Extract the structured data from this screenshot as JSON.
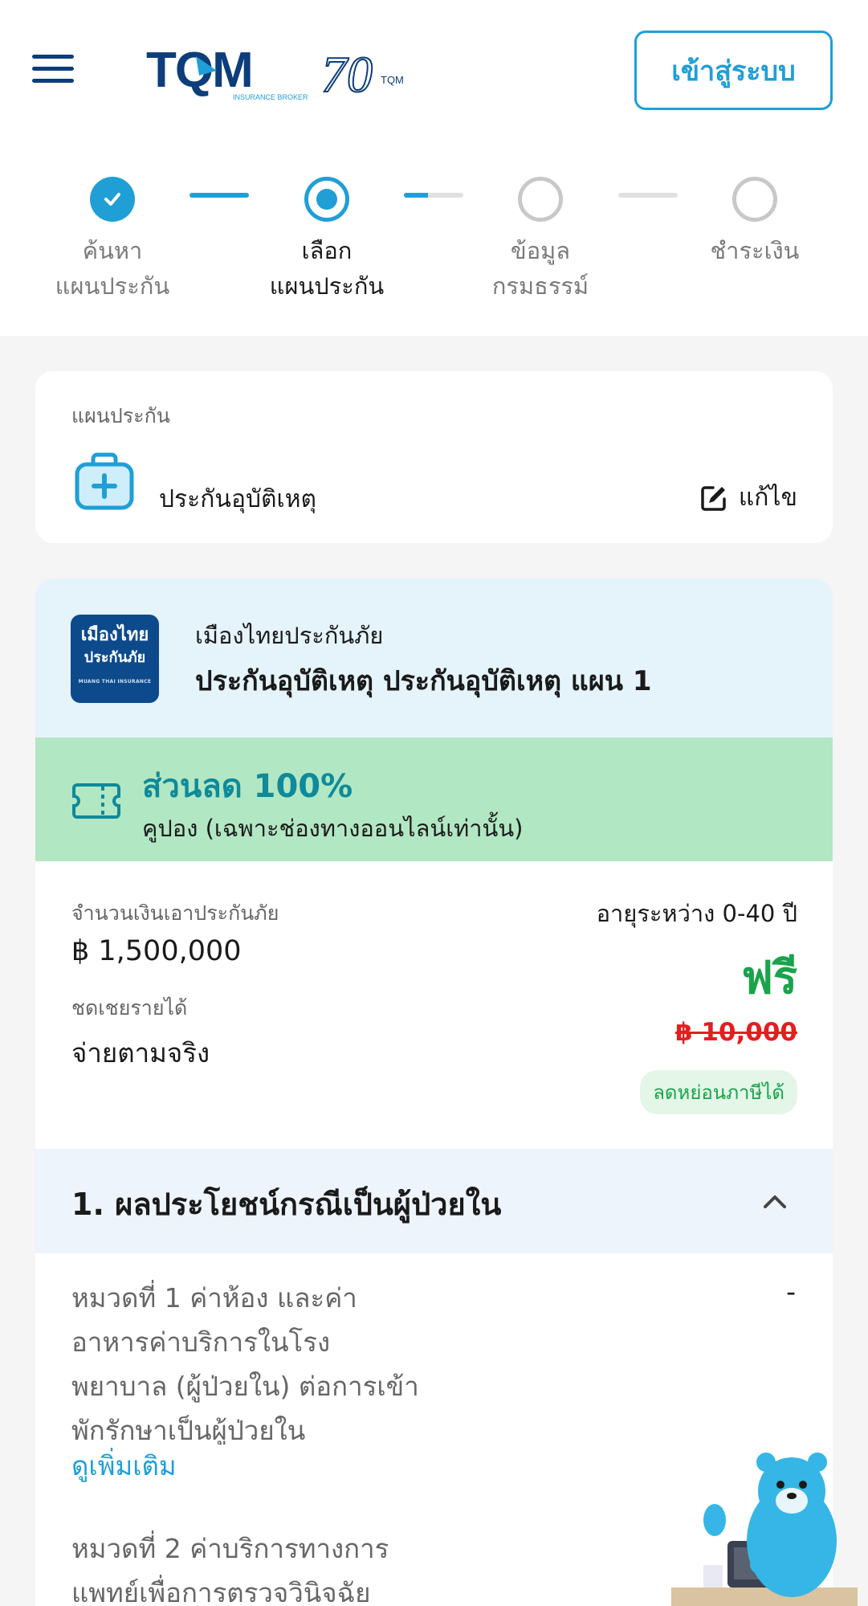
{
  "header": {
    "login_label": "เข้าสู่ระบบ",
    "logo_text": "TQM",
    "logo_sub": "INSURANCE BROKER",
    "anniversary_text": "70",
    "anniversary_sub": "TQM"
  },
  "stepper": {
    "steps": [
      {
        "line1": "ค้นหา",
        "line2": "แผนประกัน",
        "state": "done"
      },
      {
        "line1": "เลือก",
        "line2": "แผนประกัน",
        "state": "active"
      },
      {
        "line1": "ข้อมูล",
        "line2": "กรมธรรม์",
        "state": "todo"
      },
      {
        "line1": "ชำระเงิน",
        "line2": "",
        "state": "todo"
      }
    ]
  },
  "plan_type": {
    "label": "แผนประกัน",
    "name": "ประกันอุบัติเหตุ",
    "edit_label": "แก้ไข"
  },
  "insurer": {
    "logo_line1": "เมืองไทย",
    "logo_line2": "ประกันภัย",
    "logo_line3": "MUANG THAI INSURANCE",
    "name": "เมืองไทยประกันภัย",
    "plan_title": "ประกันอุบัติเหตุ ประกันอุบัติเหตุ แผน 1"
  },
  "discount": {
    "title": "ส่วนลด 100%",
    "subtitle": "คูปอง (เฉพาะช่องทางออนไลน์เท่านั้น)"
  },
  "price": {
    "sum_insured_label": "จำนวนเงินเอาประกันภัย",
    "sum_insured_value": "฿ 1,500,000",
    "compensation_label": "ชดเชยรายได้",
    "compensation_value": "จ่ายตามจริง",
    "age_range": "อายุระหว่าง 0-40 ปี",
    "price_now": "ฟรี",
    "price_old": "฿ 10,000",
    "tax_badge": "ลดหย่อนภาษีได้"
  },
  "benefits": {
    "section_title": "1. ผลประโยชน์กรณีเป็นผู้ป่วยใน",
    "item1_text": "หมวดที่ 1 ค่าห้อง และค่าอาหารค่าบริการในโรงพยาบาล (ผู้ป่วยใน) ต่อการเข้าพักรักษาเป็นผู้ป่วยใน",
    "item1_value": "-",
    "more_label": "ดูเพิ่มเติม",
    "item2_text": "หมวดที่ 2 ค่าบริการทางการแพทย์เพื่อการตรวจวินิจฉัย"
  },
  "colors": {
    "brand_blue": "#1f9fd6",
    "navy": "#0d3d7a",
    "discount_bg": "#b2e7c4",
    "free_green": "#1aa34a",
    "old_price_red": "#e02020"
  }
}
